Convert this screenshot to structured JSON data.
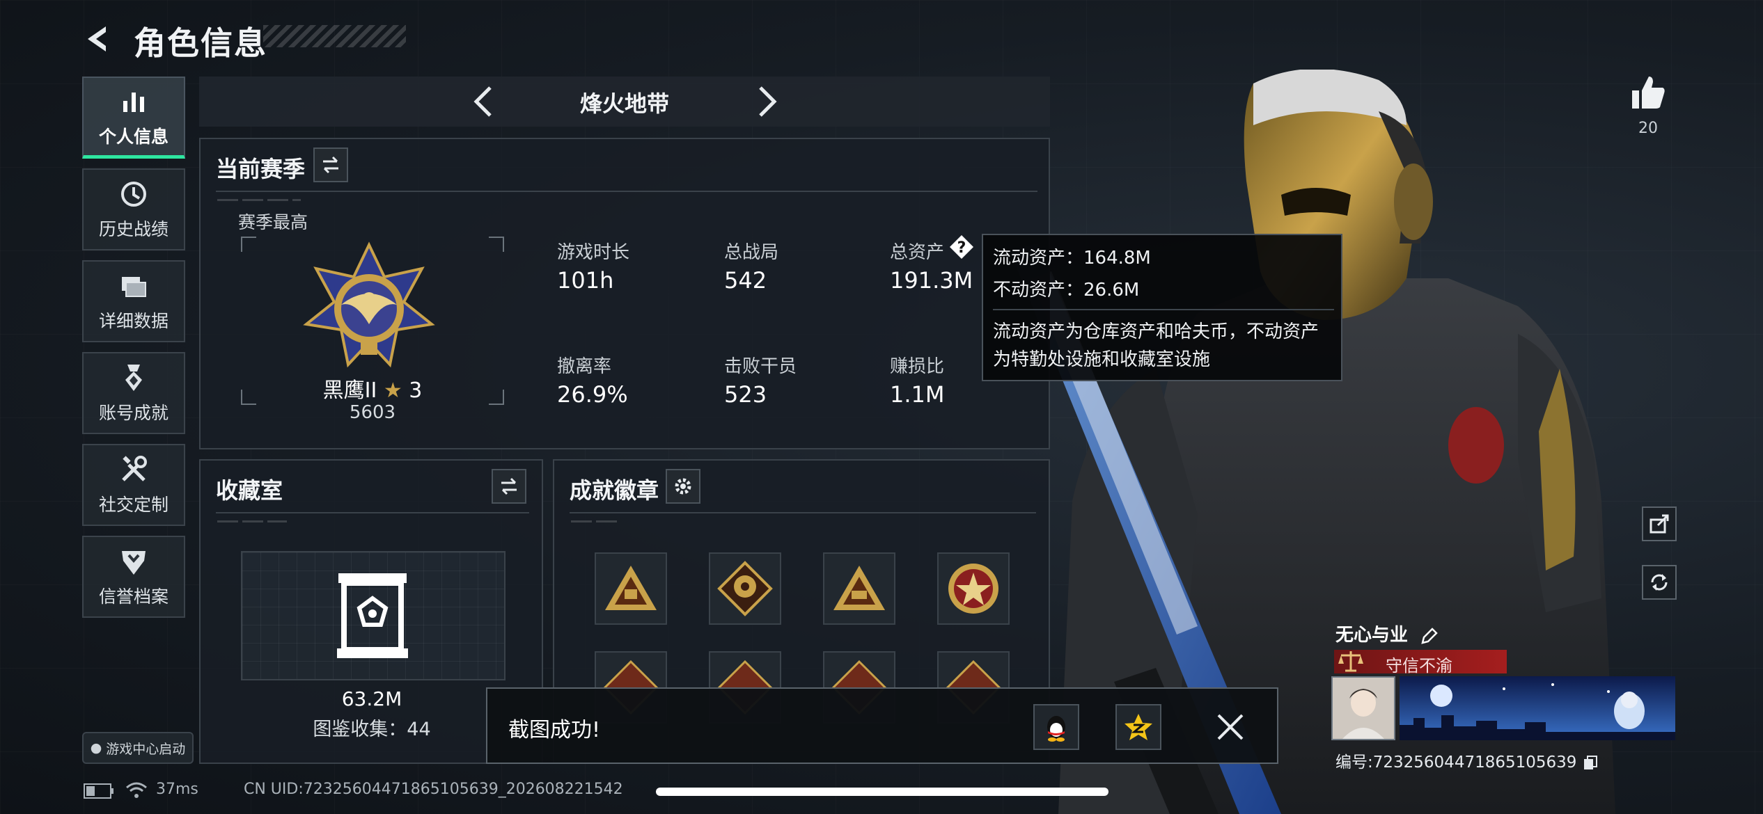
{
  "header": {
    "title": "角色信息"
  },
  "nav": [
    {
      "label": "个人信息",
      "icon": "bar-chart-icon",
      "active": true
    },
    {
      "label": "历史战绩",
      "icon": "clock-icon",
      "active": false
    },
    {
      "label": "详细数据",
      "icon": "folders-icon",
      "active": false
    },
    {
      "label": "账号成就",
      "icon": "medal-icon",
      "active": false
    },
    {
      "label": "社交定制",
      "icon": "tools-icon",
      "active": false
    },
    {
      "label": "信誉档案",
      "icon": "shield-icon",
      "active": false
    }
  ],
  "launch": {
    "label": "游戏中心启动"
  },
  "map": {
    "name": "烽火地带"
  },
  "season": {
    "title": "当前赛季",
    "high_label": "赛季最高",
    "rank": {
      "name": "黑鹰II",
      "stars": "3",
      "score": "5603"
    },
    "stats": [
      {
        "label": "游戏时长",
        "value": "101h"
      },
      {
        "label": "总战局",
        "value": "542"
      },
      {
        "label": "总资产",
        "value": "191.3M"
      },
      {
        "label": "撤离率",
        "value": "26.9%"
      },
      {
        "label": "击败干员",
        "value": "523"
      },
      {
        "label": "赚损比",
        "value": "1.1M"
      }
    ]
  },
  "tooltip": {
    "liquid": "流动资产：164.8M",
    "fixed": "不动资产：26.6M",
    "desc_line1": "流动资产为仓库资产和哈夫币，不动资产",
    "desc_line2": "为特勤处设施和收藏室设施"
  },
  "collection": {
    "title": "收藏室",
    "value": "63.2M",
    "count": "图鉴收集：44"
  },
  "achievements": {
    "title": "成就徽章"
  },
  "toast": {
    "text": "截图成功!"
  },
  "status": {
    "latency": "37ms",
    "uid": "CN UID:72325604471865105639_202608221542"
  },
  "likes": {
    "count": "20"
  },
  "player": {
    "name": "无心与业",
    "title": "守信不渝",
    "id": "编号:72325604471865105639"
  },
  "colors": {
    "accent": "#2ee6a0",
    "gold": "#c9a24a",
    "title_red": "#a51e1e"
  }
}
